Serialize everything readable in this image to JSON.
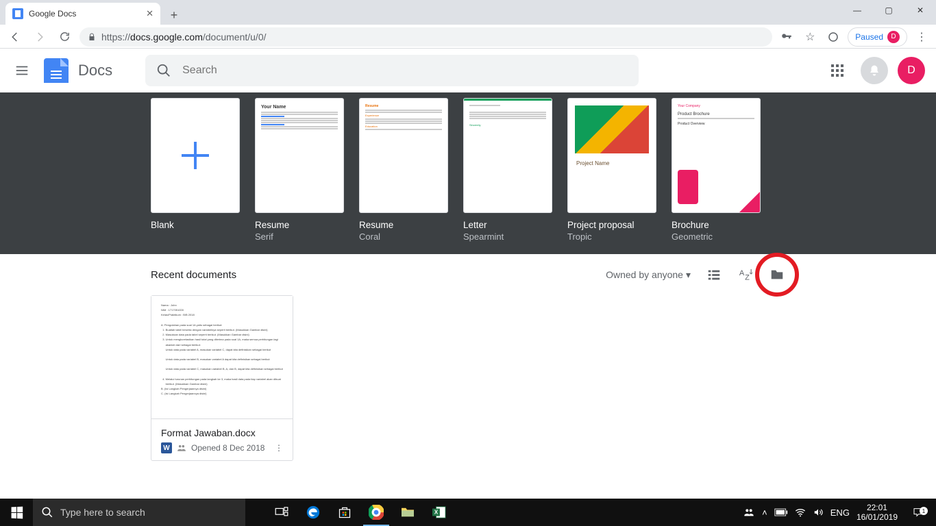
{
  "browser": {
    "tab_title": "Google Docs",
    "url_prefix": "https://",
    "url_host": "docs.google.com",
    "url_path": "/document/u/0/",
    "paused_label": "Paused",
    "paused_initial": "D"
  },
  "header": {
    "app_name": "Docs",
    "search_placeholder": "Search",
    "avatar_initial": "D"
  },
  "templates": [
    {
      "name": "Blank",
      "sub": ""
    },
    {
      "name": "Resume",
      "sub": "Serif"
    },
    {
      "name": "Resume",
      "sub": "Coral"
    },
    {
      "name": "Letter",
      "sub": "Spearmint"
    },
    {
      "name": "Project proposal",
      "sub": "Tropic"
    },
    {
      "name": "Brochure",
      "sub": "Geometric"
    }
  ],
  "recent": {
    "title": "Recent documents",
    "owned_label": "Owned by anyone",
    "docs": [
      {
        "name": "Format Jawaban.docx",
        "opened": "Opened  8 Dec 2018"
      }
    ]
  },
  "taskbar": {
    "search_placeholder": "Type here to search",
    "lang": "ENG",
    "time": "22:01",
    "date": "16/01/2019"
  }
}
